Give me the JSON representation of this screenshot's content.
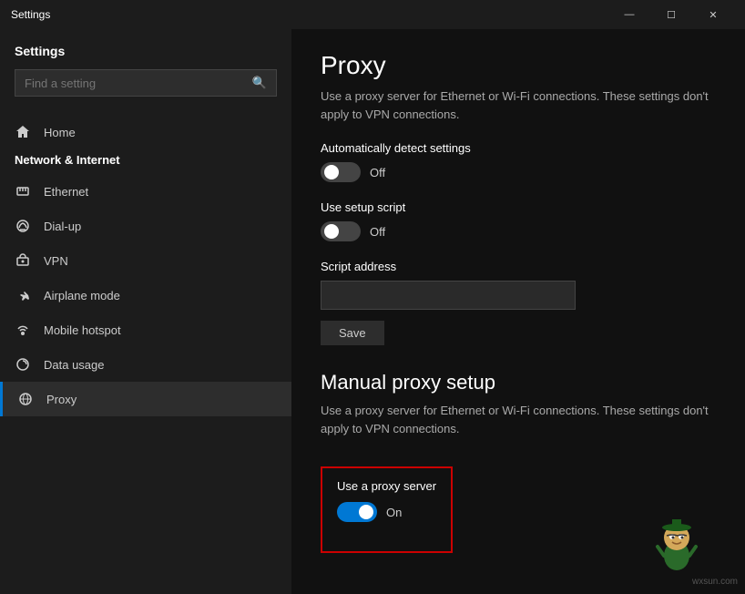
{
  "window": {
    "title": "Settings",
    "controls": {
      "minimize": "—",
      "maximize": "☐",
      "close": "✕"
    }
  },
  "sidebar": {
    "title": "Settings",
    "search": {
      "placeholder": "Find a setting",
      "value": ""
    },
    "section_label": "Network & Internet",
    "nav_items": [
      {
        "id": "home",
        "label": "Home",
        "icon": "home"
      },
      {
        "id": "ethernet",
        "label": "Ethernet",
        "icon": "ethernet"
      },
      {
        "id": "dialup",
        "label": "Dial-up",
        "icon": "dialup"
      },
      {
        "id": "vpn",
        "label": "VPN",
        "icon": "vpn"
      },
      {
        "id": "airplane",
        "label": "Airplane mode",
        "icon": "airplane"
      },
      {
        "id": "hotspot",
        "label": "Mobile hotspot",
        "icon": "hotspot"
      },
      {
        "id": "data",
        "label": "Data usage",
        "icon": "data"
      },
      {
        "id": "proxy",
        "label": "Proxy",
        "icon": "proxy",
        "active": true
      }
    ]
  },
  "main": {
    "page_title": "Proxy",
    "auto_section": {
      "description": "Use a proxy server for Ethernet or Wi-Fi connections. These settings don't apply to VPN connections.",
      "auto_detect": {
        "label": "Automatically detect settings",
        "state": "Off",
        "on": false
      },
      "setup_script": {
        "label": "Use setup script",
        "state": "Off",
        "on": false
      },
      "script_address": {
        "label": "Script address",
        "value": ""
      },
      "save_label": "Save"
    },
    "manual_section": {
      "title": "Manual proxy setup",
      "description": "Use a proxy server for Ethernet or Wi-Fi connections. These settings don't apply to VPN connections.",
      "use_proxy": {
        "label": "Use a proxy server",
        "state": "On",
        "on": true
      }
    },
    "watermark": "wxsun.com"
  }
}
